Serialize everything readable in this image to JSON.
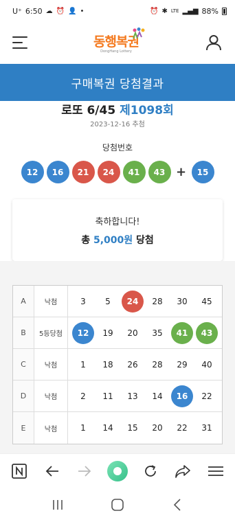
{
  "status_bar": {
    "carrier": "U⁺",
    "time": "6:50",
    "network": "LTE",
    "battery": "88%"
  },
  "header": {
    "logo_text": "동행복권",
    "logo_sub": "DongHang Lottery"
  },
  "banner": {
    "title": "구매복권 당첨결과"
  },
  "draw": {
    "game": "로또 6/45",
    "round": "제1098회",
    "date": "2023-12-16 추첨",
    "win_label": "당첨번호"
  },
  "winning_numbers": [
    {
      "num": "12",
      "color": "#3b86cf"
    },
    {
      "num": "16",
      "color": "#3b86cf"
    },
    {
      "num": "21",
      "color": "#d9574a"
    },
    {
      "num": "24",
      "color": "#d9574a"
    },
    {
      "num": "41",
      "color": "#6ab04c"
    },
    {
      "num": "43",
      "color": "#6ab04c"
    }
  ],
  "plus_sign": "+",
  "bonus_number": {
    "num": "15",
    "color": "#3b86cf"
  },
  "result": {
    "message": "축하합니다!",
    "prize_prefix": "총",
    "prize_amount": "5,000원",
    "prize_suffix": "당첨"
  },
  "ticket_rows": [
    {
      "label": "A",
      "result": "낙첨",
      "numbers": [
        {
          "n": "3"
        },
        {
          "n": "5"
        },
        {
          "n": "24",
          "color": "#d9574a"
        },
        {
          "n": "28"
        },
        {
          "n": "30"
        },
        {
          "n": "45"
        }
      ]
    },
    {
      "label": "B",
      "result": "5등당첨",
      "numbers": [
        {
          "n": "12",
          "color": "#3b86cf"
        },
        {
          "n": "19"
        },
        {
          "n": "20"
        },
        {
          "n": "35"
        },
        {
          "n": "41",
          "color": "#6ab04c"
        },
        {
          "n": "43",
          "color": "#6ab04c"
        }
      ]
    },
    {
      "label": "C",
      "result": "낙첨",
      "numbers": [
        {
          "n": "1"
        },
        {
          "n": "18"
        },
        {
          "n": "26"
        },
        {
          "n": "28"
        },
        {
          "n": "29"
        },
        {
          "n": "40"
        }
      ]
    },
    {
      "label": "D",
      "result": "낙첨",
      "numbers": [
        {
          "n": "2"
        },
        {
          "n": "11"
        },
        {
          "n": "13"
        },
        {
          "n": "14"
        },
        {
          "n": "16",
          "color": "#3b86cf"
        },
        {
          "n": "22"
        }
      ]
    },
    {
      "label": "E",
      "result": "낙첨",
      "numbers": [
        {
          "n": "1"
        },
        {
          "n": "14"
        },
        {
          "n": "15"
        },
        {
          "n": "20"
        },
        {
          "n": "22"
        },
        {
          "n": "31"
        }
      ]
    }
  ],
  "browser_toolbar": [
    "naver-icon",
    "back-icon",
    "forward-icon",
    "home-icon",
    "refresh-icon",
    "share-icon",
    "menu-icon"
  ],
  "android_nav": [
    "recent-apps-icon",
    "home-button-icon",
    "back-nav-icon"
  ],
  "colors": {
    "brand_blue": "#2f7fc4",
    "logo_orange": "#f47a20"
  }
}
